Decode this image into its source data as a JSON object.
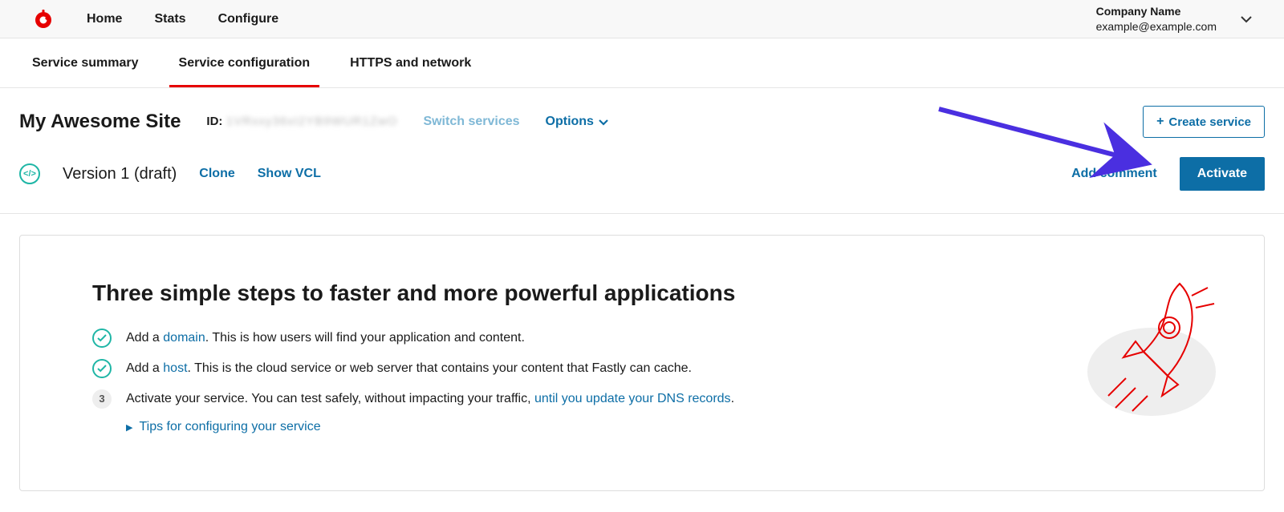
{
  "nav": {
    "home": "Home",
    "stats": "Stats",
    "configure": "Configure"
  },
  "account": {
    "company": "Company Name",
    "email": "example@example.com"
  },
  "tabs": {
    "summary": "Service summary",
    "config": "Service configuration",
    "https": "HTTPS and network"
  },
  "service": {
    "title": "My Awesome Site",
    "id_label": "ID:",
    "id_value": "1VRxxy36xI2YB9WUR1ZwO",
    "switch": "Switch services",
    "options": "Options",
    "create_btn": "Create service"
  },
  "version": {
    "label": "Version 1 (draft)",
    "clone": "Clone",
    "show_vcl": "Show VCL",
    "add_comment": "Add comment",
    "activate": "Activate"
  },
  "guide": {
    "heading": "Three simple steps to faster and more powerful applications",
    "step1_pre": "Add a ",
    "step1_link": "domain",
    "step1_post": ". This is how users will find your application and content.",
    "step2_pre": "Add a ",
    "step2_link": "host",
    "step2_post": ". This is the cloud service or web server that contains your content that Fastly can cache.",
    "step3_pre": "Activate your service. You can test safely, without impacting your traffic, ",
    "step3_link": "until you update your DNS records",
    "step3_post": ".",
    "step3_num": "3",
    "tips": "Tips for configuring your service"
  }
}
